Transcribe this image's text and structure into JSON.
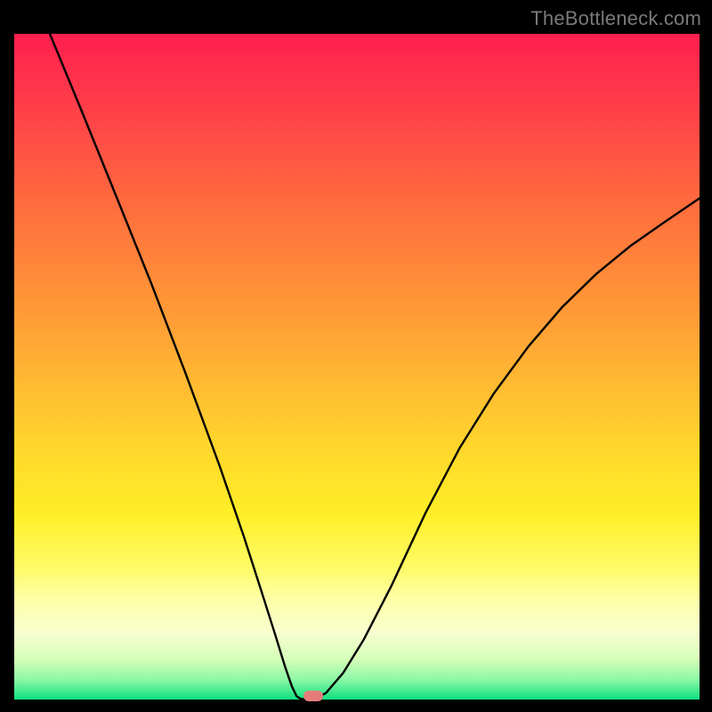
{
  "watermark": "TheBottleneck.com",
  "chart_data": {
    "type": "line",
    "title": "",
    "xlabel": "",
    "ylabel": "",
    "xlim": [
      0,
      1
    ],
    "ylim": [
      0,
      1
    ],
    "series": [
      {
        "name": "curve",
        "x": [
          0.052,
          0.1,
          0.15,
          0.2,
          0.25,
          0.3,
          0.335,
          0.36,
          0.38,
          0.395,
          0.405,
          0.412,
          0.418,
          0.425,
          0.437,
          0.455,
          0.48,
          0.51,
          0.55,
          0.6,
          0.65,
          0.7,
          0.75,
          0.8,
          0.85,
          0.9,
          0.95,
          1.0
        ],
        "y": [
          1.0,
          0.88,
          0.753,
          0.625,
          0.49,
          0.35,
          0.245,
          0.165,
          0.1,
          0.05,
          0.02,
          0.005,
          0.001,
          0.0,
          0.0,
          0.01,
          0.04,
          0.09,
          0.17,
          0.28,
          0.378,
          0.46,
          0.53,
          0.59,
          0.64,
          0.682,
          0.718,
          0.753
        ]
      }
    ],
    "gridlines": false,
    "legend": false,
    "marker": {
      "x": 0.436,
      "y": 0.005,
      "color": "#e57c7c"
    },
    "background_gradient": {
      "top": "#ff1f4e",
      "bottom": "#0ee07f"
    }
  }
}
